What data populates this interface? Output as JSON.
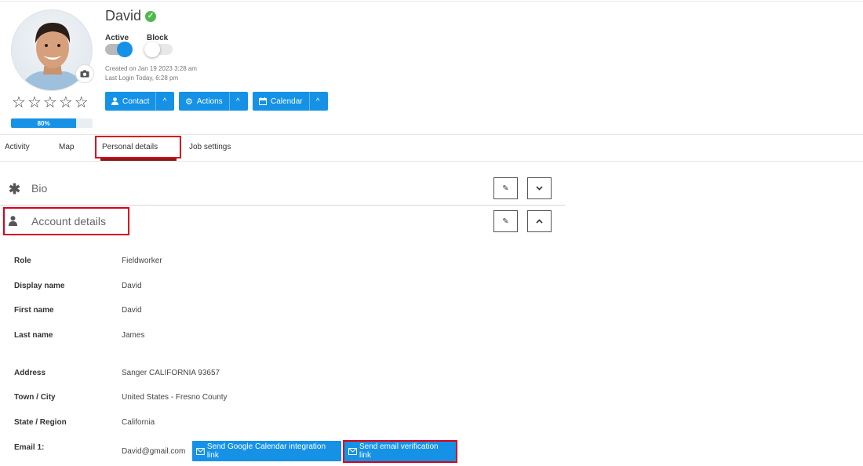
{
  "profile": {
    "name": "David",
    "rating_stars": 5,
    "rating_value": 0,
    "progress_percent": 80,
    "progress_label": "80%",
    "active_label": "Active",
    "active_on": true,
    "block_label": "Block",
    "block_on": false,
    "created": "Created on Jan 19 2023 3:28 am",
    "last_login": "Last Login Today, 6:28 pm"
  },
  "actions": [
    {
      "label": "Contact",
      "icon": "user-icon"
    },
    {
      "label": "Actions",
      "icon": "gear-icon"
    },
    {
      "label": "Calendar",
      "icon": "calendar-icon"
    }
  ],
  "tabs": [
    {
      "label": "Activity",
      "active": false
    },
    {
      "label": "Map",
      "active": false
    },
    {
      "label": "Personal details",
      "active": true
    },
    {
      "label": "Job settings",
      "active": false
    }
  ],
  "sections": {
    "bio": {
      "title": "Bio",
      "icon": "asterisk-icon",
      "expanded": false
    },
    "account": {
      "title": "Account details",
      "icon": "user-icon",
      "expanded": true
    }
  },
  "fields": [
    {
      "label": "Role",
      "value": "Fieldworker"
    },
    {
      "label": "Display name",
      "value": "David"
    },
    {
      "label": "First name",
      "value": "David"
    },
    {
      "label": "Last name",
      "value": "James"
    },
    {
      "label": "Address",
      "value": "Sanger CALIFORNIA 93657"
    },
    {
      "label": "Town / City",
      "value": "United States - Fresno County"
    },
    {
      "label": "State / Region",
      "value": "California"
    },
    {
      "label": "Email 1:",
      "value": "David@gmail.com"
    }
  ],
  "email_buttons": {
    "google_calendar": "Send Google Calendar integration link",
    "verification": "Send email verification link"
  },
  "colors": {
    "primary": "#1592e6",
    "verified": "#4cbb4a",
    "highlight": "#d9001b"
  }
}
